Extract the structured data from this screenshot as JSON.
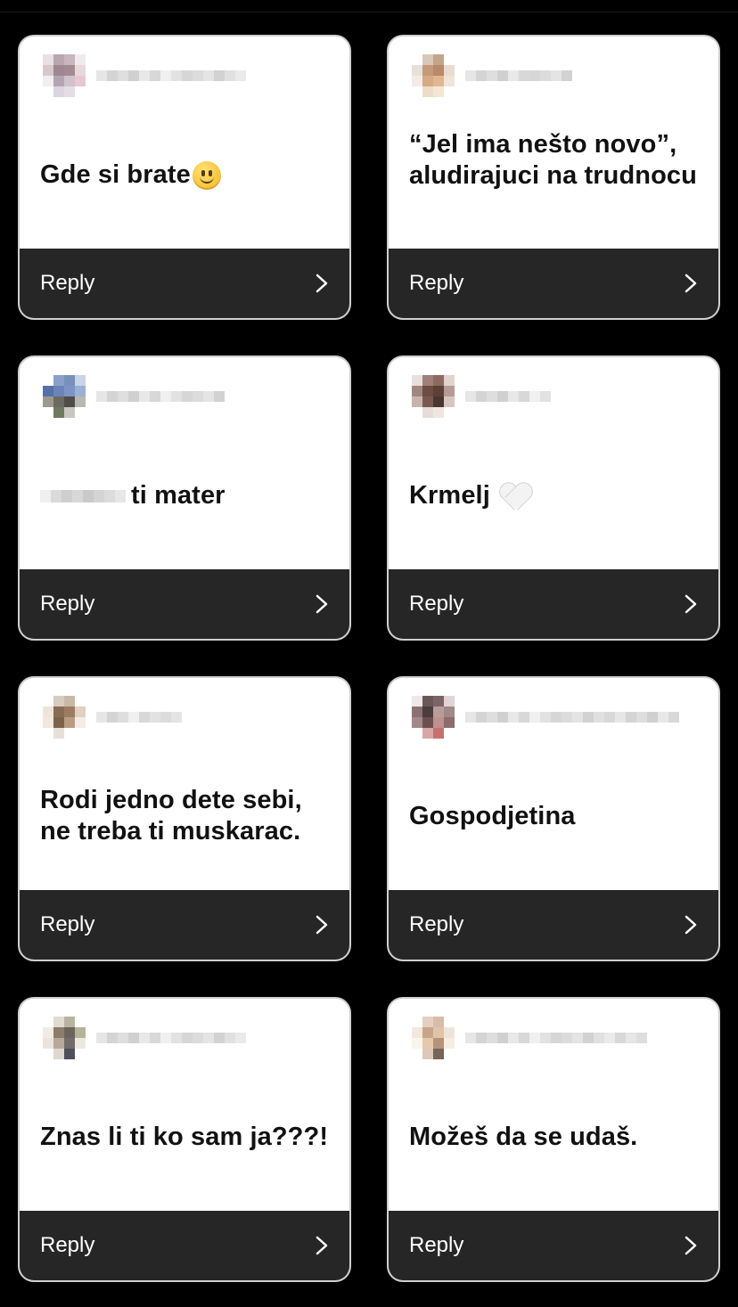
{
  "cards": [
    {
      "username": "",
      "message": "Gde si brate",
      "reply_label": "Reply",
      "emoji": "slightly-smiling-face"
    },
    {
      "username": "",
      "message": "“Jel ima nešto novo”, aludirajuci na trudnocu",
      "reply_label": "Reply"
    },
    {
      "username": "",
      "message": "ti mater",
      "reply_label": "Reply",
      "redacted_prefix": true
    },
    {
      "username": "",
      "message": "Krmelj",
      "reply_label": "Reply",
      "emoji": "white-heart"
    },
    {
      "username": "",
      "message": "Rodi jedno dete sebi, ne treba ti muskarac.",
      "reply_label": "Reply"
    },
    {
      "username": "",
      "message": "Gospodjetina",
      "reply_label": "Reply"
    },
    {
      "username": "",
      "message": "Znas li ti ko sam ja???!",
      "reply_label": "Reply"
    },
    {
      "username": "",
      "message": "Možeš da se udaš.",
      "reply_label": "Reply"
    }
  ],
  "colors": {
    "background": "#000000",
    "card": "#ffffff",
    "reply_bar": "#262626",
    "text": "#111111"
  }
}
